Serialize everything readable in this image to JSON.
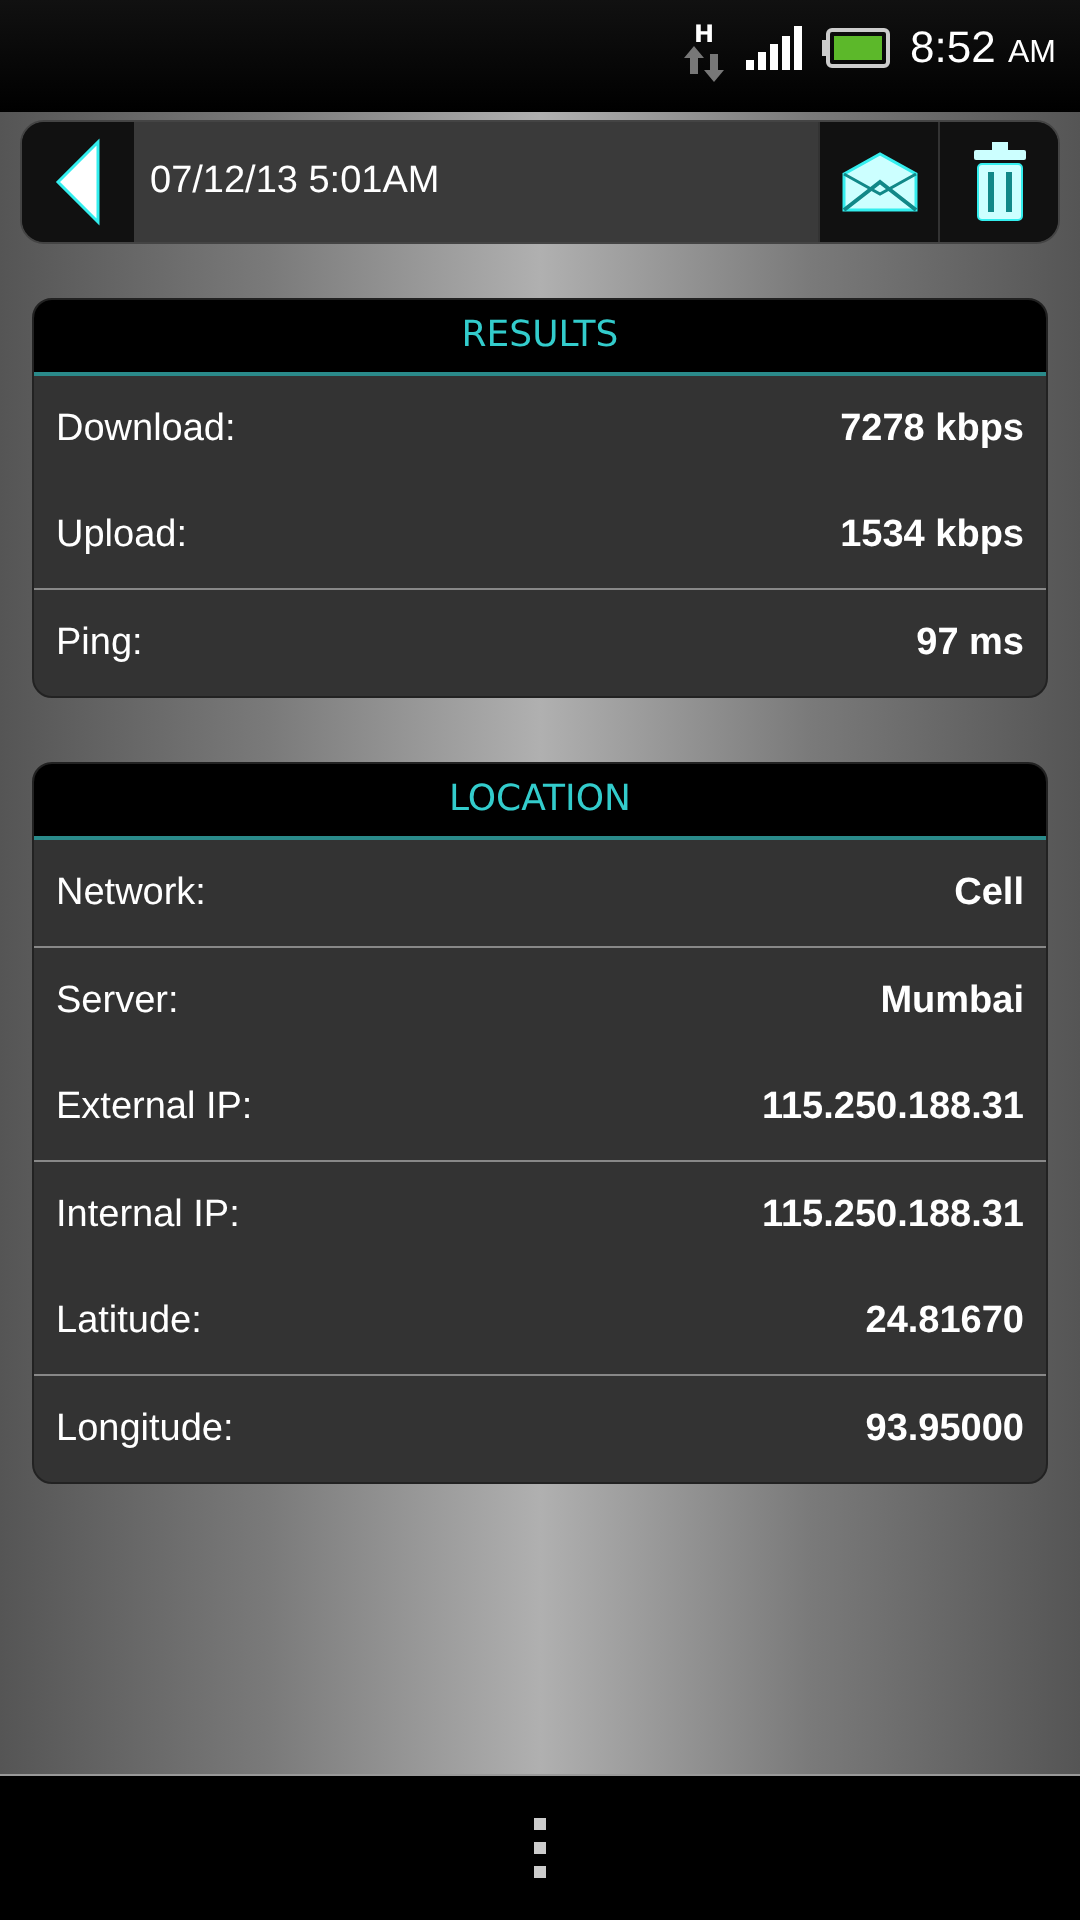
{
  "status_bar": {
    "network_type": "H",
    "time": "8:52",
    "meridiem": "AM"
  },
  "toolbar": {
    "title": "07/12/13 5:01AM"
  },
  "sections": [
    {
      "title": "RESULTS",
      "groups": [
        {
          "rows": [
            {
              "label": "Download:",
              "value": "7278 kbps"
            },
            {
              "label": "Upload:",
              "value": "1534 kbps"
            }
          ]
        },
        {
          "rows": [
            {
              "label": "Ping:",
              "value": "97 ms"
            }
          ]
        }
      ]
    },
    {
      "title": "LOCATION",
      "groups": [
        {
          "rows": [
            {
              "label": "Network:",
              "value": "Cell"
            }
          ]
        },
        {
          "rows": [
            {
              "label": "Server:",
              "value": "Mumbai"
            },
            {
              "label": "External IP:",
              "value": "115.250.188.31"
            }
          ]
        },
        {
          "rows": [
            {
              "label": "Internal IP:",
              "value": "115.250.188.31"
            },
            {
              "label": "Latitude:",
              "value": "24.81670"
            }
          ]
        },
        {
          "rows": [
            {
              "label": "Longitude:",
              "value": "93.95000"
            }
          ]
        }
      ]
    }
  ]
}
